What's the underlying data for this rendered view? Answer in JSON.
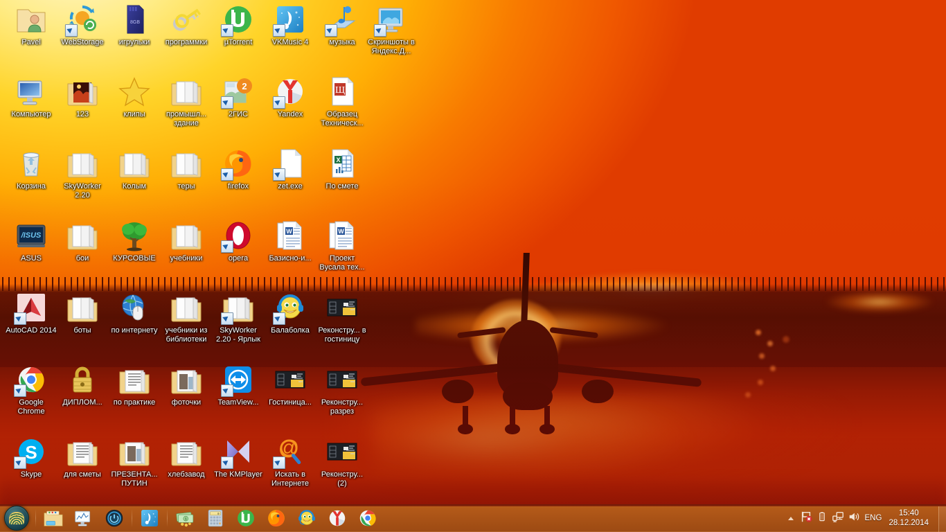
{
  "desktop": {
    "wallpaper_description": "airplane landing at fiery sunset",
    "colors": {
      "sky_top": "#ffec86",
      "sky_mid": "#ff9a00",
      "sky_bottom": "#e03c00",
      "ground": "#5a1005",
      "taskbar": "#a85216",
      "taskbar_border": "#7a1c09",
      "label_text": "#ffffff"
    }
  },
  "icons": [
    {
      "label": "Pavel",
      "icon": "folder-user-icon",
      "type": "folder",
      "shortcut": false,
      "col": 0,
      "row": 0
    },
    {
      "label": "WebStorage",
      "icon": "webstorage-sync-icon",
      "type": "app",
      "shortcut": true,
      "col": 1,
      "row": 0
    },
    {
      "label": "игрульки",
      "icon": "sd-card-icon",
      "type": "app",
      "shortcut": false,
      "col": 2,
      "row": 0
    },
    {
      "label": "программки",
      "icon": "keys-icon",
      "type": "app",
      "shortcut": false,
      "col": 3,
      "row": 0
    },
    {
      "label": "µTorrent",
      "icon": "utorrent-icon",
      "type": "app",
      "shortcut": true,
      "col": 4,
      "row": 0
    },
    {
      "label": "VKMusic 4",
      "icon": "vkmusic-icon",
      "type": "app",
      "shortcut": true,
      "col": 5,
      "row": 0
    },
    {
      "label": "музыка",
      "icon": "music-note-icon",
      "type": "app",
      "shortcut": true,
      "col": 6,
      "row": 0
    },
    {
      "label": "Скриншоты в Яндекс.Д...",
      "icon": "yandex-disk-screenshot-icon",
      "type": "app",
      "shortcut": true,
      "col": 7,
      "row": 0
    },
    {
      "label": "Компьютер",
      "icon": "computer-icon",
      "type": "system",
      "shortcut": false,
      "col": 0,
      "row": 1
    },
    {
      "label": "123",
      "icon": "folder-picture-icon",
      "type": "folder",
      "shortcut": false,
      "col": 1,
      "row": 1
    },
    {
      "label": "клипы",
      "icon": "star-icon",
      "type": "app",
      "shortcut": false,
      "col": 2,
      "row": 1
    },
    {
      "label": "промышл... здание",
      "icon": "folder-icon",
      "type": "folder",
      "shortcut": false,
      "col": 3,
      "row": 1
    },
    {
      "label": "2ГИС",
      "icon": "2gis-icon",
      "type": "app",
      "shortcut": true,
      "col": 4,
      "row": 1
    },
    {
      "label": "Yandex",
      "icon": "yandex-browser-icon",
      "type": "app",
      "shortcut": true,
      "col": 5,
      "row": 1
    },
    {
      "label": "Образец Техническ...",
      "icon": "wordpad-doc-icon",
      "type": "document",
      "shortcut": false,
      "col": 6,
      "row": 1
    },
    {
      "label": "Корзина",
      "icon": "recycle-bin-icon",
      "type": "system",
      "shortcut": false,
      "col": 0,
      "row": 2
    },
    {
      "label": "SkyWorker 2.20",
      "icon": "folder-icon",
      "type": "folder",
      "shortcut": false,
      "col": 1,
      "row": 2
    },
    {
      "label": "Колым",
      "icon": "folder-icon",
      "type": "folder",
      "shortcut": false,
      "col": 2,
      "row": 2
    },
    {
      "label": "теры",
      "icon": "folder-icon",
      "type": "folder",
      "shortcut": false,
      "col": 3,
      "row": 2
    },
    {
      "label": "firefox",
      "icon": "firefox-icon",
      "type": "app",
      "shortcut": true,
      "col": 4,
      "row": 2
    },
    {
      "label": "zet.exe",
      "icon": "blank-exe-icon",
      "type": "app",
      "shortcut": true,
      "col": 5,
      "row": 2
    },
    {
      "label": "По смете",
      "icon": "excel-doc-icon",
      "type": "document",
      "shortcut": false,
      "col": 6,
      "row": 2
    },
    {
      "label": "ASUS",
      "icon": "asus-icon",
      "type": "app",
      "shortcut": false,
      "col": 0,
      "row": 3
    },
    {
      "label": "бои",
      "icon": "folder-icon",
      "type": "folder",
      "shortcut": false,
      "col": 1,
      "row": 3
    },
    {
      "label": "КУРСОВЫЕ",
      "icon": "tree-icon",
      "type": "folder",
      "shortcut": false,
      "col": 2,
      "row": 3
    },
    {
      "label": "учебники",
      "icon": "folder-icon",
      "type": "folder",
      "shortcut": false,
      "col": 3,
      "row": 3
    },
    {
      "label": "opera",
      "icon": "opera-icon",
      "type": "app",
      "shortcut": true,
      "col": 4,
      "row": 3
    },
    {
      "label": "Базисно-и...",
      "icon": "word-doc-icon",
      "type": "document",
      "shortcut": false,
      "col": 5,
      "row": 3
    },
    {
      "label": "Проект Вусала тех...",
      "icon": "word-doc-icon",
      "type": "document",
      "shortcut": false,
      "col": 6,
      "row": 3
    },
    {
      "label": "AutoCAD 2014",
      "icon": "autocad-icon",
      "type": "app",
      "shortcut": true,
      "col": 0,
      "row": 4
    },
    {
      "label": "боты",
      "icon": "folder-icon",
      "type": "folder",
      "shortcut": false,
      "col": 1,
      "row": 4
    },
    {
      "label": "по интернету",
      "icon": "globe-mouse-icon",
      "type": "folder",
      "shortcut": false,
      "col": 2,
      "row": 4
    },
    {
      "label": "учебники из библиотеки",
      "icon": "folder-icon",
      "type": "folder",
      "shortcut": false,
      "col": 3,
      "row": 4
    },
    {
      "label": "SkyWorker 2.20 - Ярлык",
      "icon": "folder-icon",
      "type": "folder",
      "shortcut": true,
      "col": 4,
      "row": 4
    },
    {
      "label": "Балаболка",
      "icon": "balabolka-icon",
      "type": "app",
      "shortcut": true,
      "col": 5,
      "row": 4
    },
    {
      "label": "Реконстру... в гостиницу",
      "icon": "dwg-thumbnail-icon",
      "type": "drawing",
      "shortcut": false,
      "col": 6,
      "row": 4
    },
    {
      "label": "Google Chrome",
      "icon": "chrome-icon",
      "type": "app",
      "shortcut": true,
      "col": 0,
      "row": 5
    },
    {
      "label": "ДИПЛОМ...",
      "icon": "padlock-icon",
      "type": "folder",
      "shortcut": false,
      "col": 1,
      "row": 5
    },
    {
      "label": "по практике",
      "icon": "folder-doc-icon",
      "type": "folder",
      "shortcut": false,
      "col": 2,
      "row": 5
    },
    {
      "label": "фоточки",
      "icon": "folder-photo-icon",
      "type": "folder",
      "shortcut": false,
      "col": 3,
      "row": 5
    },
    {
      "label": "TeamView...",
      "icon": "teamviewer-icon",
      "type": "app",
      "shortcut": true,
      "col": 4,
      "row": 5
    },
    {
      "label": "Гостиница...",
      "icon": "dwg-thumbnail-icon",
      "type": "drawing",
      "shortcut": false,
      "col": 5,
      "row": 5
    },
    {
      "label": "Реконстру... разрез",
      "icon": "dwg-thumbnail-icon",
      "type": "drawing",
      "shortcut": false,
      "col": 6,
      "row": 5
    },
    {
      "label": "Skype",
      "icon": "skype-icon",
      "type": "app",
      "shortcut": true,
      "col": 0,
      "row": 6
    },
    {
      "label": "для сметы",
      "icon": "folder-doc-icon",
      "type": "folder",
      "shortcut": false,
      "col": 1,
      "row": 6
    },
    {
      "label": "ПРЕЗЕНТА... ПУТИН",
      "icon": "folder-photo-icon",
      "type": "folder",
      "shortcut": false,
      "col": 2,
      "row": 6
    },
    {
      "label": "хлебзавод",
      "icon": "folder-doc-icon",
      "type": "folder",
      "shortcut": false,
      "col": 3,
      "row": 6
    },
    {
      "label": "The KMPlayer",
      "icon": "kmplayer-icon",
      "type": "app",
      "shortcut": true,
      "col": 4,
      "row": 6
    },
    {
      "label": "Искать в Интернете",
      "icon": "search-web-icon",
      "type": "app",
      "shortcut": true,
      "col": 5,
      "row": 6
    },
    {
      "label": "Реконстру... (2)",
      "icon": "dwg-thumbnail-icon",
      "type": "drawing",
      "shortcut": false,
      "col": 6,
      "row": 6
    }
  ],
  "taskbar": {
    "start": {
      "label": "Start",
      "icon": "start-orb-icon"
    },
    "quicklaunch": [
      {
        "name": "explorer",
        "icon": "folder-explorer-icon"
      },
      {
        "name": "performance",
        "icon": "monitor-chart-icon"
      },
      {
        "name": "power-manager",
        "icon": "power-circle-icon"
      }
    ],
    "quicklaunch2": [
      {
        "name": "vkmusic",
        "icon": "vkmusic-icon"
      }
    ],
    "quicklaunch3": [
      {
        "name": "money",
        "icon": "banknotes-icon"
      },
      {
        "name": "calculator",
        "icon": "calculator-icon"
      }
    ],
    "running": [
      {
        "name": "utorrent",
        "icon": "utorrent-icon"
      },
      {
        "name": "firefox",
        "icon": "firefox-icon"
      },
      {
        "name": "balabolka",
        "icon": "balabolka-icon"
      },
      {
        "name": "yandex",
        "icon": "yandex-browser-icon"
      },
      {
        "name": "chrome",
        "icon": "chrome-icon"
      }
    ],
    "tray": {
      "expand_icon": "chevron-up-icon",
      "icons": [
        {
          "name": "action-center",
          "icon": "flag-alert-icon",
          "badge": "error"
        },
        {
          "name": "battery",
          "icon": "battery-icon",
          "badge": ""
        },
        {
          "name": "network",
          "icon": "network-monitor-icon",
          "badge": ""
        },
        {
          "name": "volume",
          "icon": "speaker-icon",
          "badge": ""
        }
      ],
      "language": "ENG",
      "time": "15:40",
      "date": "28.12.2014"
    }
  }
}
